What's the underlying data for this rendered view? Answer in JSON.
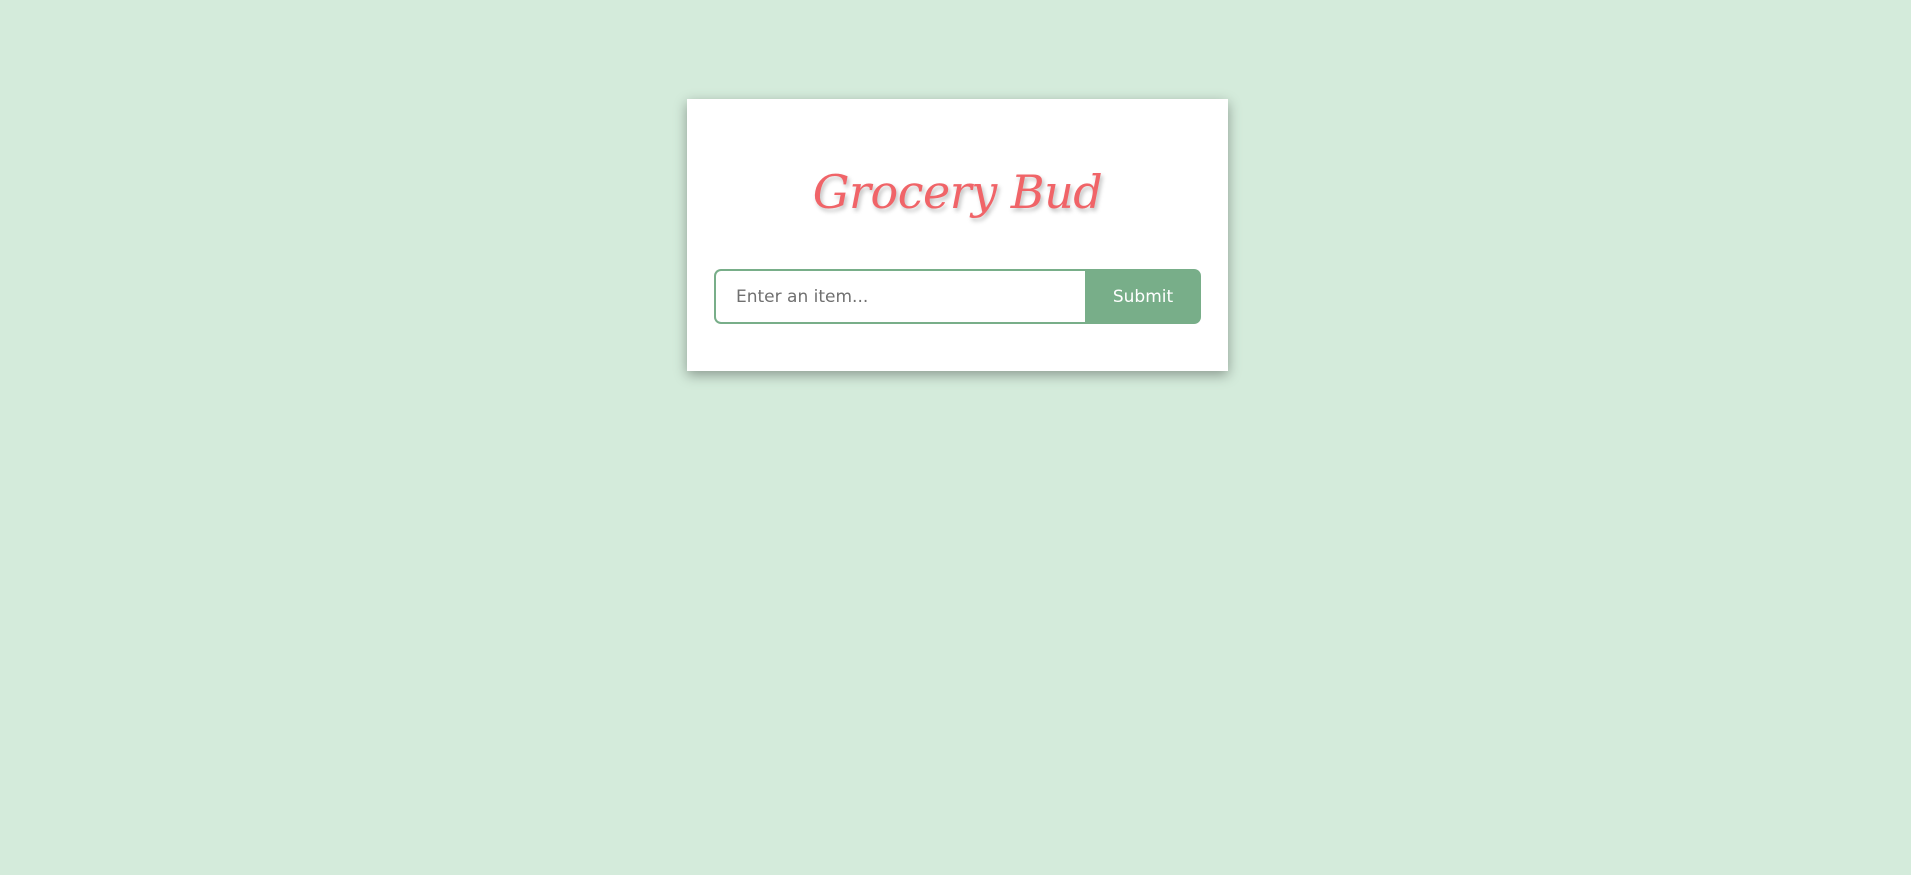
{
  "app": {
    "title": "Grocery Bud"
  },
  "form": {
    "input_placeholder": "Enter an item...",
    "input_value": "",
    "submit_label": "Submit"
  },
  "colors": {
    "background": "#d4ebdb",
    "card": "#ffffff",
    "title": "#f06468",
    "accent": "#78ae89"
  }
}
